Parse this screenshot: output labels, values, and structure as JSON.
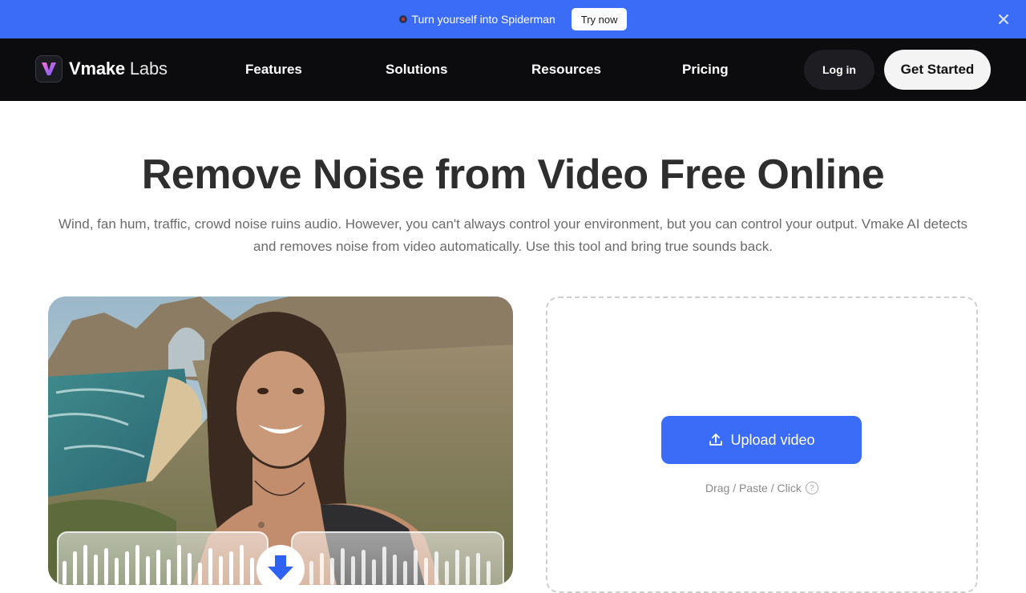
{
  "announcement": {
    "text": "Turn yourself into Spiderman",
    "button_label": "Try now",
    "icon": "spider-icon",
    "background": "#3b6cf7"
  },
  "nav": {
    "brand_bold": "Vmake",
    "brand_light": "Labs",
    "items": [
      "Features",
      "Solutions",
      "Resources",
      "Pricing"
    ],
    "login_label": "Log in",
    "get_started_label": "Get Started"
  },
  "hero": {
    "title": "Remove Noise from Video Free Online",
    "description": "Wind, fan hum, traffic, crowd noise ruins audio. However, you can't always control your environment, but you can control your output. Vmake AI detects and removes noise from video automatically. Use this tool and bring true sounds back."
  },
  "upload": {
    "button_label": "Upload video",
    "hint": "Drag / Paste / Click",
    "accent": "#3b6cf7"
  }
}
